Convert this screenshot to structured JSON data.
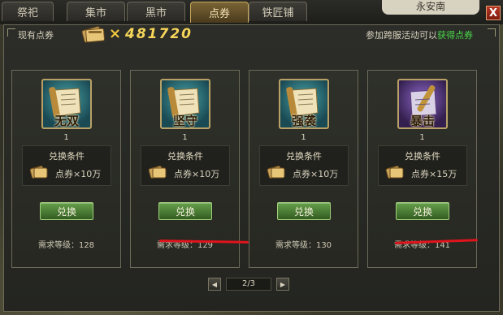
{
  "tabs": [
    {
      "label": "祭祀",
      "active": false
    },
    {
      "label": "集市",
      "active": false
    },
    {
      "label": "黑市",
      "active": false
    },
    {
      "label": "点券",
      "active": true
    },
    {
      "label": "铁匠铺",
      "active": false
    }
  ],
  "location": "永安南",
  "close_label": "X",
  "currency": {
    "label": "现有点券",
    "times": "×",
    "value": "481720",
    "icon": "ticket-icon"
  },
  "promo": {
    "text": "参加跨服活动可以",
    "link": "获得点券"
  },
  "cards": [
    {
      "item_name": "无双",
      "qty": "1",
      "cond_title": "兑换条件",
      "cost": "点券×10万",
      "button": "兑换",
      "level": "需求等级：128",
      "theme": "teal"
    },
    {
      "item_name": "坚守",
      "qty": "1",
      "cond_title": "兑换条件",
      "cost": "点券×10万",
      "button": "兑换",
      "level": "需求等级：129",
      "theme": "teal"
    },
    {
      "item_name": "强袭",
      "qty": "1",
      "cond_title": "兑换条件",
      "cost": "点券×10万",
      "button": "兑换",
      "level": "需求等级：130",
      "theme": "teal"
    },
    {
      "item_name": "暴击",
      "qty": "1",
      "cond_title": "兑换条件",
      "cost": "点券×15万",
      "button": "兑换",
      "level": "需求等级：141",
      "theme": "purple"
    }
  ],
  "pager": {
    "prev": "◀",
    "text": "2/3",
    "next": "▶"
  },
  "colors": {
    "accent_red": "#e0141c",
    "gold": "#f6d55a",
    "green_link": "#49d84a"
  }
}
